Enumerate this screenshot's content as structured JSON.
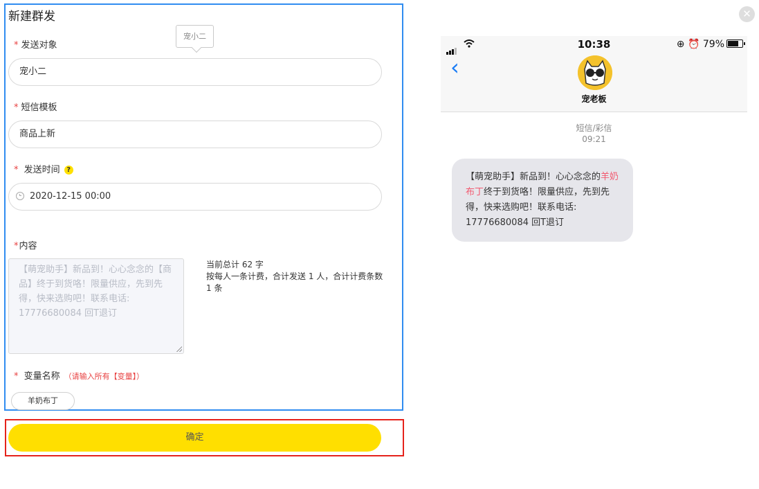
{
  "form": {
    "title": "新建群发",
    "tooltip": "宠小二",
    "recipient_label": "发送对象",
    "recipient_value": "宠小二",
    "template_label": "短信模板",
    "template_value": "商品上新",
    "time_label": "发送时间",
    "time_value": "2020-12-15 00:00",
    "content_label": "内容",
    "content_text": "【萌宠助手】新品到！心心念念的【商品】终于到货咯！限量供应，先到先得，快来选购吧！联系电话: 17776680084 回T退订",
    "counter_line1": "当前总计 62 字",
    "counter_line2": "按每人一条计费，合计发送 1 人，合计计费条数 1 条",
    "variable_label": "变量名称",
    "variable_hint": "（请输入所有【变量】）",
    "variable_value": "羊奶布丁",
    "confirm_label": "确定"
  },
  "phone": {
    "time": "10:38",
    "battery": "79%",
    "contact_name": "宠老板",
    "message_type": "短信/彩信",
    "message_time": "09:21",
    "message_prefix": "【萌宠助手】新品到！心心念念的",
    "message_variable": "羊奶布丁",
    "message_suffix": "终于到货咯！限量供应，先到先得，快来选购吧！联系电话: 17776680084 回T退订"
  },
  "colors": {
    "accent_blue": "#2f8cf0",
    "confirm_yellow": "#ffdf00",
    "highlight_red": "#e5221b",
    "variable_pink": "#f2596f"
  },
  "icons": [
    "help-icon",
    "clock-icon",
    "close-icon",
    "back-icon",
    "wifi-icon",
    "signal-icon",
    "battery-icon",
    "avatar"
  ]
}
